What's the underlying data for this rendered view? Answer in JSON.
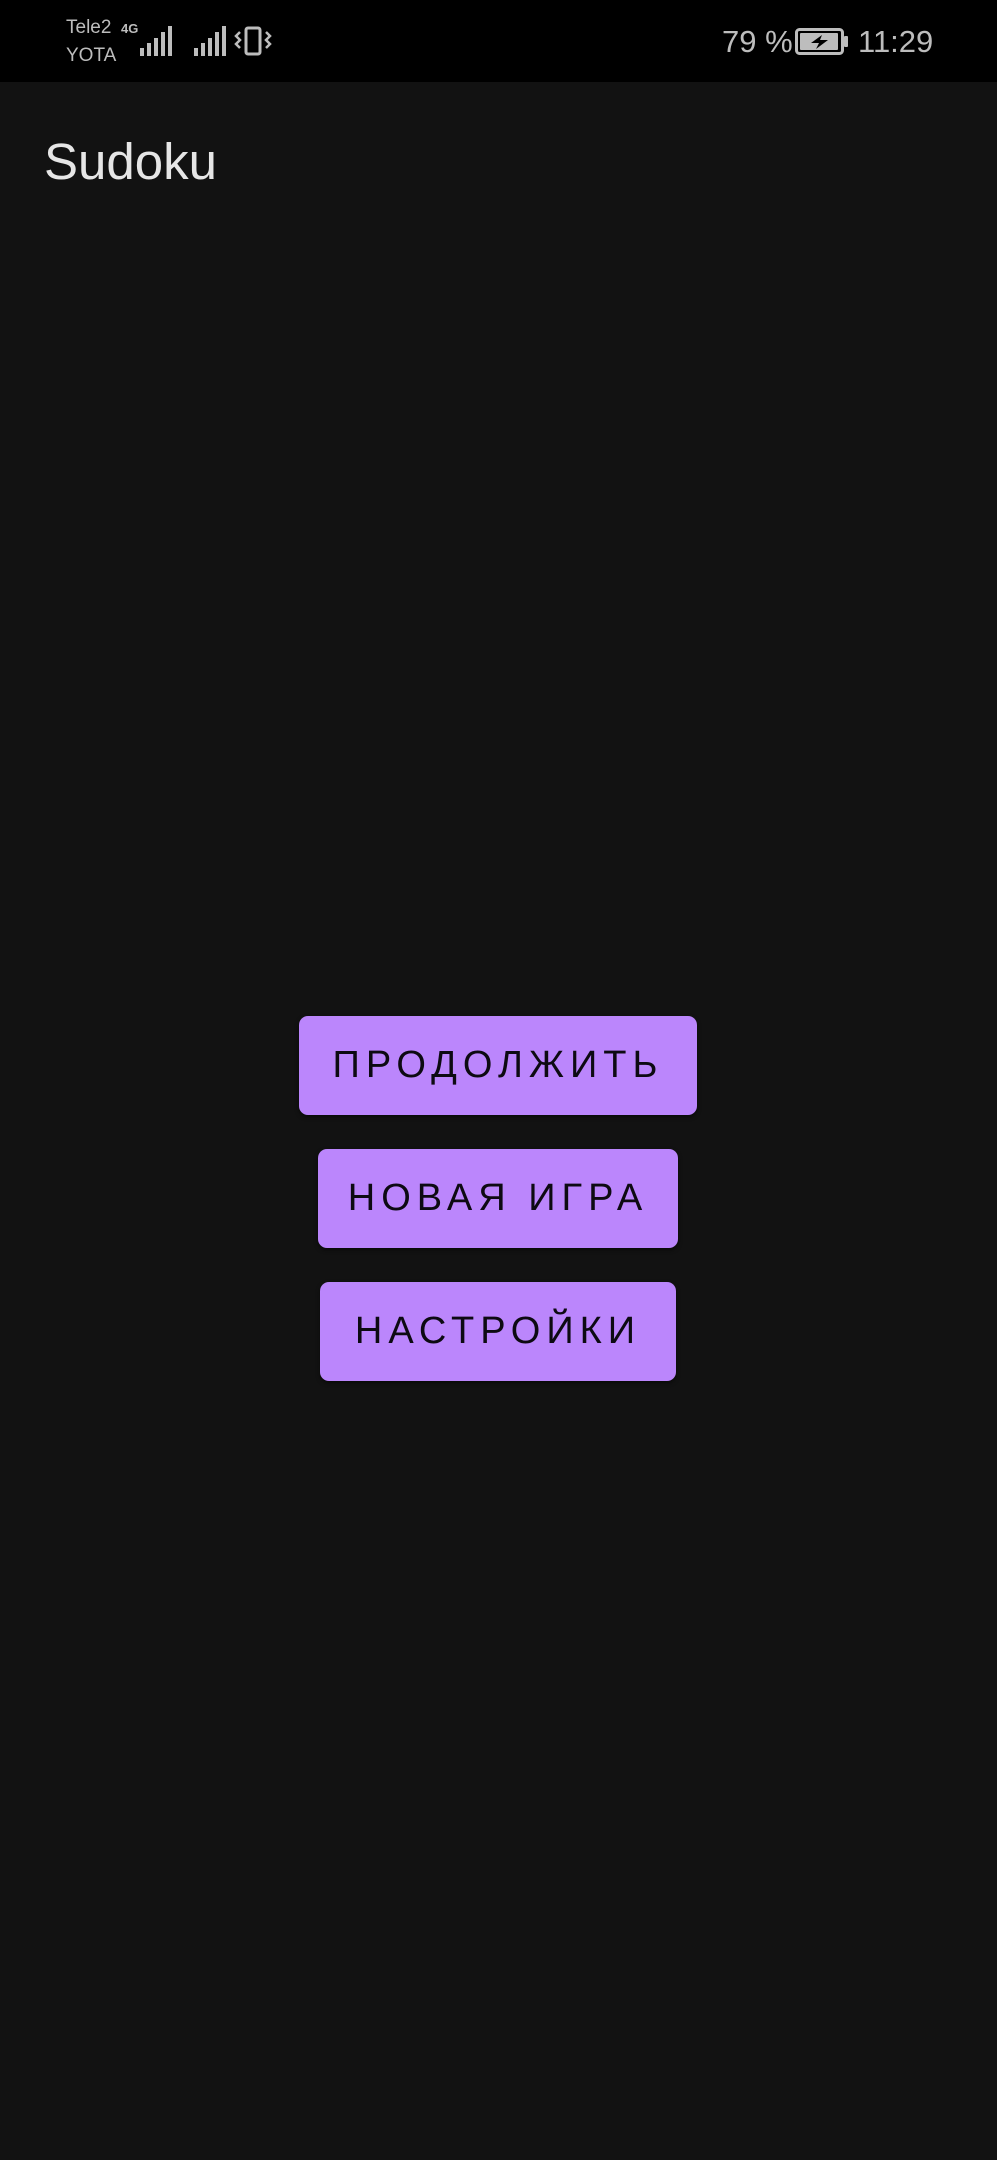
{
  "status_bar": {
    "carrier_1": "Tele2",
    "carrier_2": "YOTA",
    "network_type": "4G",
    "battery_percent": "79 %",
    "time": "11:29",
    "icons": [
      "signal-icon",
      "signal-icon",
      "vibrate-icon",
      "battery-charging-icon"
    ]
  },
  "app_bar": {
    "title": "Sudoku"
  },
  "menu": {
    "continue_label": "ПРОДОЛЖИТЬ",
    "new_game_label": "НОВАЯ ИГРА",
    "settings_label": "НАСТРОЙКИ"
  },
  "colors": {
    "background": "#121212",
    "status_bar": "#000000",
    "accent": "#bb86fc",
    "title_text": "#e6e6e6"
  }
}
